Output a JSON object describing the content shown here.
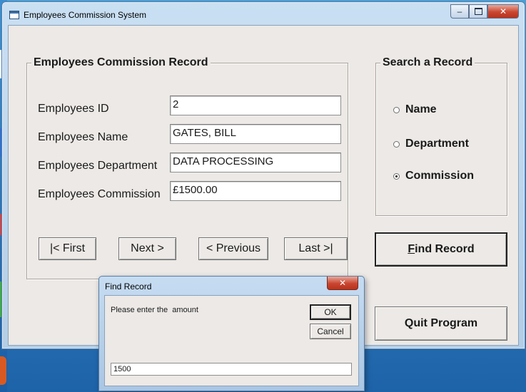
{
  "window": {
    "title": "Employees Commission System"
  },
  "record_group": {
    "label": "Employees Commission Record",
    "fields": [
      {
        "label": "Employees ID",
        "value": "2"
      },
      {
        "label": "Employees Name",
        "value": "GATES, BILL"
      },
      {
        "label": "Employees Department",
        "value": "DATA PROCESSING"
      },
      {
        "label": "Employees Commission",
        "value": "£1500.00"
      }
    ],
    "nav_buttons": [
      "|< First",
      "Next >",
      "< Previous",
      "Last >|"
    ]
  },
  "search_group": {
    "label": "Search a Record",
    "options": [
      "Name",
      "Department",
      "Commission"
    ],
    "selected": "Commission"
  },
  "actions": {
    "find_record_label": "Find Record",
    "find_record_mnemonic": "F",
    "find_record_rest": "ind Record",
    "quit_label": "Quit Program"
  },
  "dialog": {
    "title": "Find Record",
    "prompt": "Please enter the  amount",
    "ok_label": "OK",
    "cancel_label": "Cancel",
    "input_value": "1500"
  },
  "colors": {
    "close_red": "#c9452f",
    "window_frame": "#b3cde6",
    "client_bg": "#ece9e6"
  }
}
